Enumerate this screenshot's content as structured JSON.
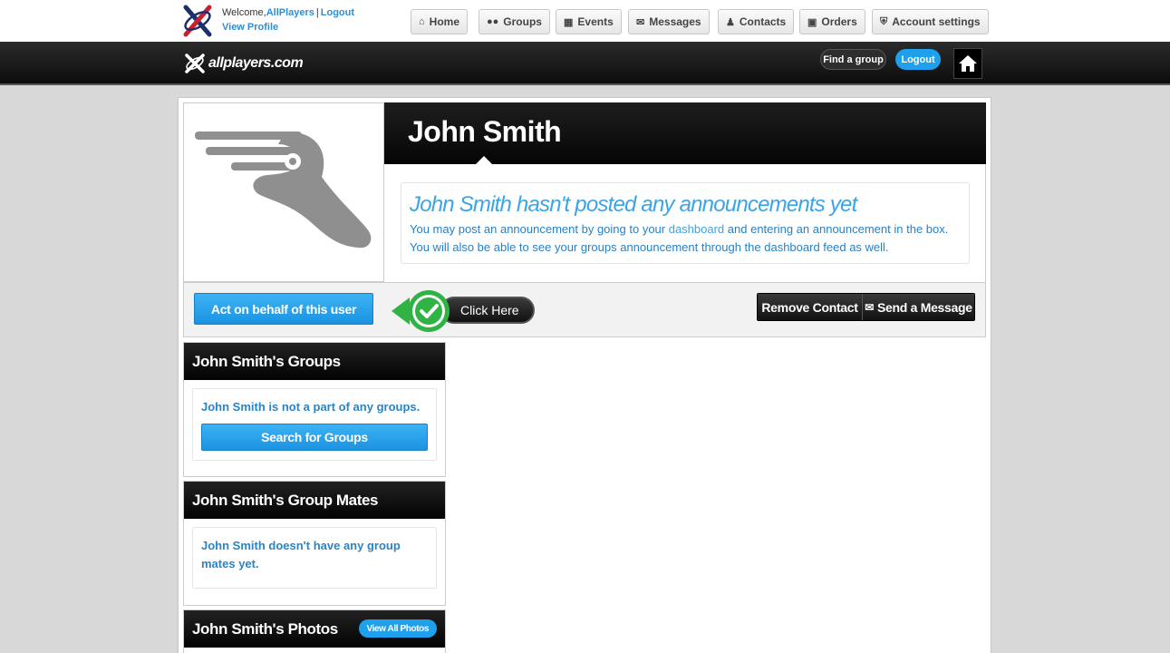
{
  "topbar": {
    "welcome_prefix": "Welcome,",
    "username": "AllPlayers",
    "separator": "|",
    "logout": "Logout",
    "view_profile": "View Profile",
    "nav": [
      {
        "label": "Home",
        "icon": "home-icon"
      },
      {
        "label": "Groups",
        "icon": "groups-icon"
      },
      {
        "label": "Events",
        "icon": "calendar-icon"
      },
      {
        "label": "Messages",
        "icon": "envelope-icon"
      },
      {
        "label": "Contacts",
        "icon": "user-icon"
      },
      {
        "label": "Orders",
        "icon": "cart-icon"
      },
      {
        "label": "Account settings",
        "icon": "shield-icon"
      }
    ]
  },
  "brandbar": {
    "brand": "allplayers.com",
    "find_group": "Find a group",
    "logout": "Logout"
  },
  "profile": {
    "name": "John Smith",
    "notice_title": "John Smith hasn't posted any announcements yet",
    "notice_line1_pre": "You may post an announcement by going to your ",
    "notice_link": "dashboard",
    "notice_line1_post": " and entering an announcement in the box.",
    "notice_line2": "You will also be able to see your groups announcement through the dashboard feed as well."
  },
  "actions": {
    "act_on_behalf": "Act on behalf of this user",
    "click_here": "Click Here",
    "remove_contact": "Remove Contact",
    "send_message": "Send a Message"
  },
  "widgets": {
    "groups": {
      "title": "John Smith's Groups",
      "text": "John Smith is not a part of any groups.",
      "button": "Search for Groups"
    },
    "group_mates": {
      "title": "John Smith's Group Mates",
      "text": "John Smith doesn't have any group mates yet."
    },
    "photos": {
      "title": "John Smith's Photos",
      "button": "View All Photos"
    }
  },
  "colors": {
    "accent_blue": "#1ea0ec",
    "link_blue": "#2b8fd6",
    "check_green": "#2fb344"
  }
}
